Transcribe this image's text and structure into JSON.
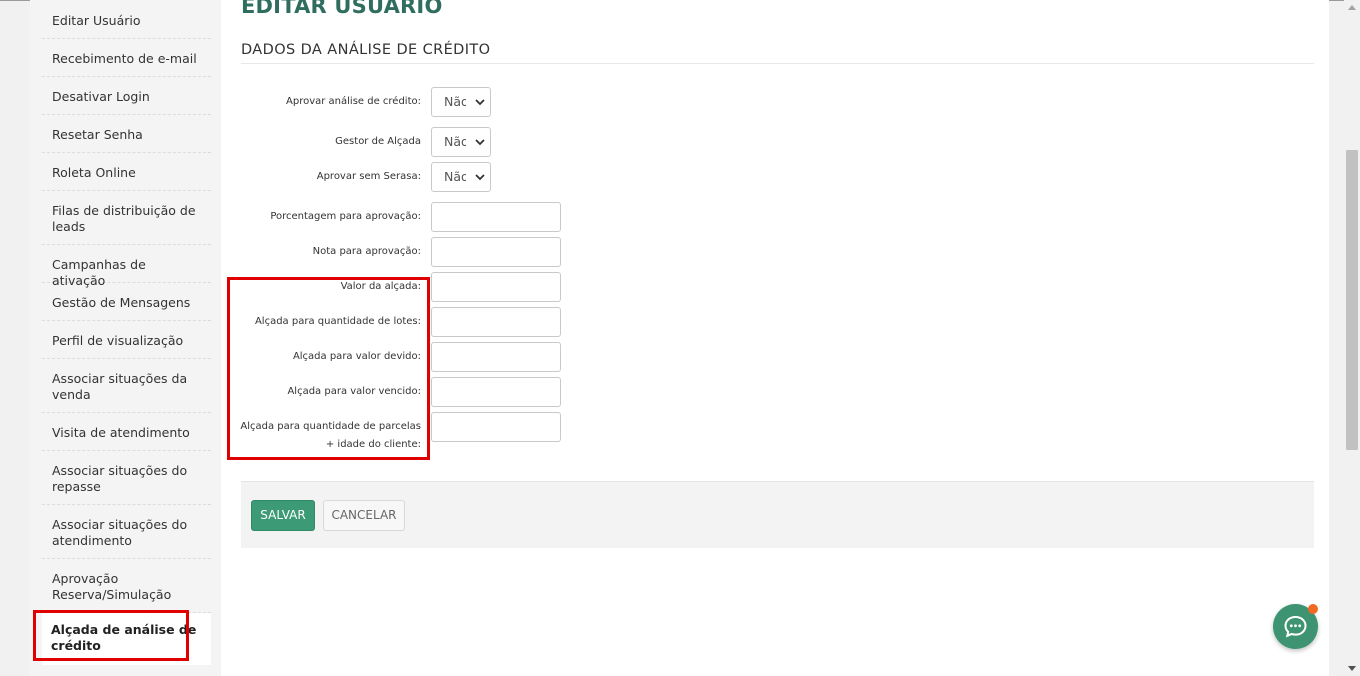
{
  "sidebar": {
    "items": [
      {
        "label": "Editar Usuário"
      },
      {
        "label": "Recebimento de e-mail"
      },
      {
        "label": "Desativar Login"
      },
      {
        "label": "Resetar Senha"
      },
      {
        "label": "Roleta Online"
      },
      {
        "label": "Filas de distribuição de leads"
      },
      {
        "label": "Campanhas de ativação"
      },
      {
        "label": "Gestão de Mensagens"
      },
      {
        "label": "Perfil de visualização"
      },
      {
        "label": "Associar situações da venda"
      },
      {
        "label": "Visita de atendimento"
      },
      {
        "label": "Associar situações do repasse"
      },
      {
        "label": "Associar situações do atendimento"
      },
      {
        "label": "Aprovação Reserva/Simulação"
      },
      {
        "label": "Alçada de análise de crédito"
      }
    ],
    "active_index": 14
  },
  "main": {
    "page_title": "EDITAR USUÁRIO",
    "section_title": "DADOS DA ANÁLISE DE CRÉDITO",
    "form": {
      "aprovar_analise": {
        "label": "Aprovar análise de crédito:",
        "value": "Não"
      },
      "gestor_alcada": {
        "label": "Gestor de Alçada",
        "value": "Não"
      },
      "aprovar_sem_serasa": {
        "label": "Aprovar sem Serasa:",
        "value": "Não"
      },
      "porcentagem": {
        "label": "Porcentagem para aprovação:",
        "value": ""
      },
      "nota": {
        "label": "Nota para aprovação:",
        "value": ""
      },
      "valor_alcada": {
        "label": "Valor da alçada:",
        "value": ""
      },
      "alcada_lotes": {
        "label": "Alçada para quantidade de lotes:",
        "value": ""
      },
      "alcada_valor_devido": {
        "label": "Alçada para valor devido:",
        "value": ""
      },
      "alcada_valor_vencido": {
        "label": "Alçada para valor vencido:",
        "value": ""
      },
      "alcada_parcelas": {
        "label_line1": "Alçada para quantidade de parcelas",
        "label_line2": "+ idade do cliente:",
        "value": ""
      }
    },
    "actions": {
      "save_label": "SALVAR",
      "cancel_label": "CANCELAR"
    }
  },
  "colors": {
    "title": "#2f6d5f",
    "save_button": "#3c9a76",
    "highlight": "#e10000",
    "chat_button": "#3d9372",
    "chat_notification": "#f26a21"
  },
  "icons": {
    "chat": "chat-bubble-icon",
    "select_chevron": "chevron-down-icon"
  }
}
